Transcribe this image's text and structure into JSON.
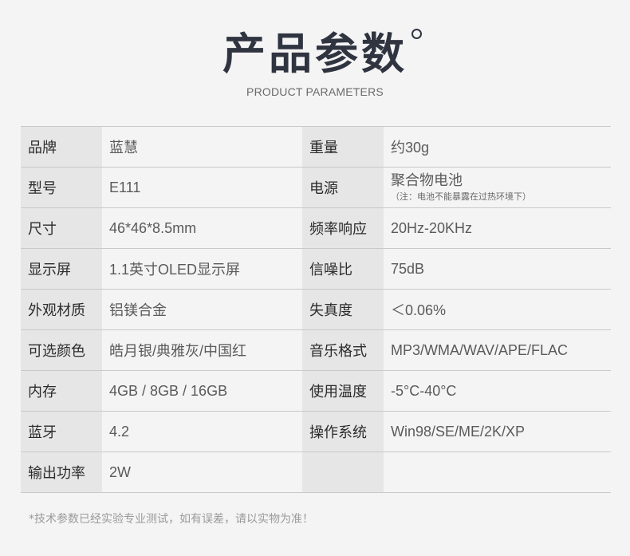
{
  "header": {
    "title": "产品参数",
    "subtitle": "PRODUCT PARAMETERS"
  },
  "rows": [
    {
      "l1": "品牌",
      "v1": "蓝慧",
      "l2": "重量",
      "v2": "约30g"
    },
    {
      "l1": "型号",
      "v1": "E111",
      "l2": "电源",
      "v2": "聚合物电池",
      "v2_note": "（注：电池不能暴露在过热环境下）"
    },
    {
      "l1": "尺寸",
      "v1": "46*46*8.5mm",
      "l2": "频率响应",
      "v2": "20Hz-20KHz"
    },
    {
      "l1": "显示屏",
      "v1": "1.1英寸OLED显示屏",
      "l2": "信噪比",
      "v2": "75dB"
    },
    {
      "l1": "外观材质",
      "v1": "铝镁合金",
      "l2": "失真度",
      "v2": "＜0.06%"
    },
    {
      "l1": "可选颜色",
      "v1": "皓月银/典雅灰/中国红",
      "l2": "音乐格式",
      "v2": "MP3/WMA/WAV/APE/FLAC"
    },
    {
      "l1": "内存",
      "v1": "4GB / 8GB / 16GB",
      "l2": "使用温度",
      "v2": "-5°C-40°C"
    },
    {
      "l1": "蓝牙",
      "v1": "4.2",
      "l2": "操作系统",
      "v2": "Win98/SE/ME/2K/XP"
    },
    {
      "l1": "输出功率",
      "v1": "2W",
      "l2": "",
      "v2": ""
    }
  ],
  "footer": {
    "note": "*技术参数已经实验专业测试，如有误差，请以实物为准！"
  }
}
